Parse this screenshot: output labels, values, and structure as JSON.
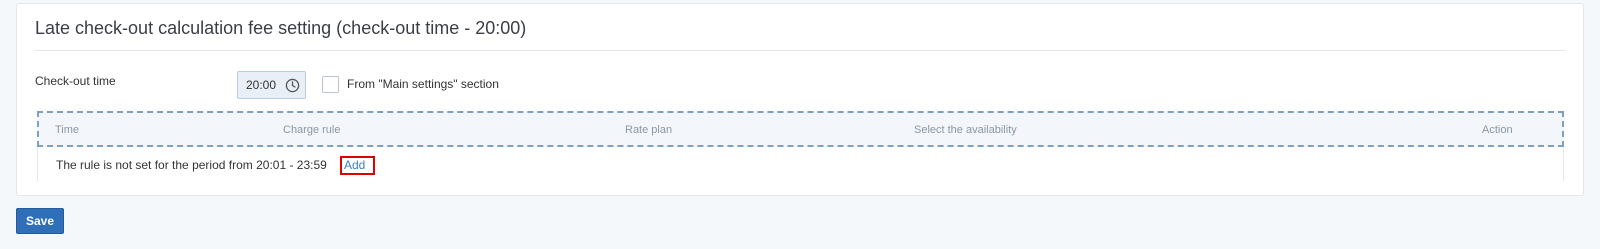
{
  "section": {
    "title": "Late check-out calculation fee setting (check-out time - 20:00)"
  },
  "checkout": {
    "label": "Check-out time",
    "time_value": "20:00",
    "time_icon": "clock-icon",
    "main_settings_checked": false,
    "main_settings_label": "From \"Main settings\" section"
  },
  "table": {
    "columns": [
      "Time",
      "Charge rule",
      "Rate plan",
      "Select the availability",
      "Action"
    ],
    "empty_row_text": "The rule is not set for the period from 20:01 - 23:59",
    "add_link_label": "Add"
  },
  "footer": {
    "save_label": "Save"
  },
  "colors": {
    "accent": "#2f6fb8",
    "link": "#3c7fc4",
    "highlight": "#e00000"
  }
}
